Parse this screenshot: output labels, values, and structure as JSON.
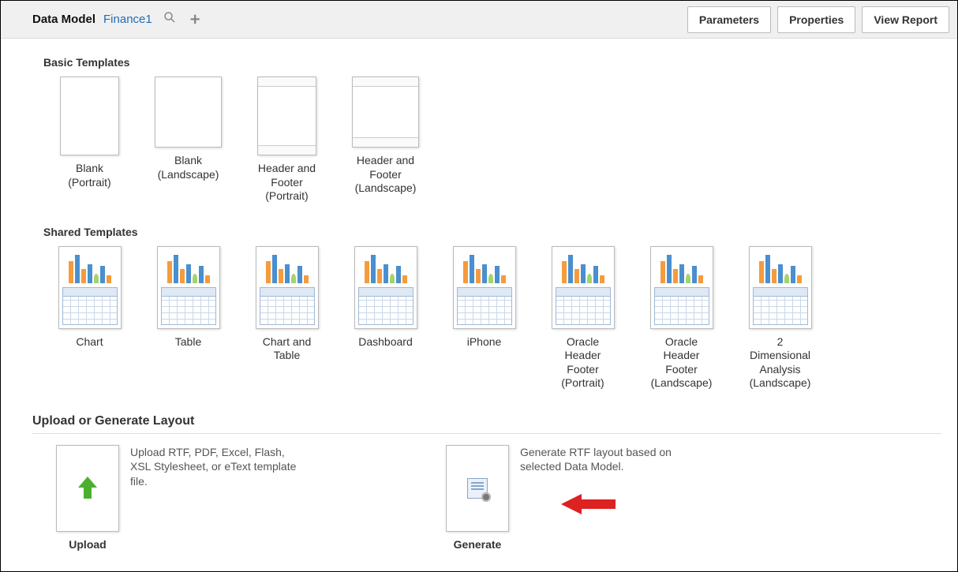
{
  "header": {
    "label": "Data Model",
    "value": "Finance1",
    "buttons": {
      "parameters": "Parameters",
      "properties": "Properties",
      "view_report": "View Report"
    }
  },
  "sections": {
    "basic": {
      "title": "Basic Templates",
      "items": [
        {
          "label": "Blank (Portrait)"
        },
        {
          "label": "Blank (Landscape)"
        },
        {
          "label": "Header and Footer (Portrait)"
        },
        {
          "label": "Header and Footer (Landscape)"
        }
      ]
    },
    "shared": {
      "title": "Shared Templates",
      "items": [
        {
          "label": "Chart"
        },
        {
          "label": "Table"
        },
        {
          "label": "Chart and Table"
        },
        {
          "label": "Dashboard"
        },
        {
          "label": "iPhone"
        },
        {
          "label": "Oracle Header Footer (Portrait)"
        },
        {
          "label": "Oracle Header Footer (Landscape)"
        },
        {
          "label": "2 Dimensional Analysis (Landscape)"
        }
      ]
    },
    "uploadgen": {
      "title": "Upload or Generate Layout",
      "upload": {
        "caption": "Upload",
        "desc": "Upload RTF, PDF, Excel, Flash, XSL Stylesheet, or eText template file."
      },
      "generate": {
        "caption": "Generate",
        "desc": "Generate RTF layout based on selected Data Model."
      }
    }
  }
}
